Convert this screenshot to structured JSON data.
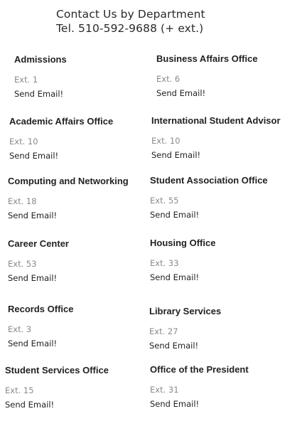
{
  "header": {
    "title": "Contact Us by Department",
    "phone": "Tel. 510-592-9688 (+ ext.)"
  },
  "departments": [
    {
      "name": "Admissions",
      "ext": "Ext. 1",
      "email_label": "Send Email!"
    },
    {
      "name": "Business Affairs Office",
      "ext": "Ext. 6",
      "email_label": "Send Email!"
    },
    {
      "name": "Academic Affairs Office",
      "ext": "Ext. 10",
      "email_label": "Send Email!"
    },
    {
      "name": "International Student Advisor",
      "ext": "Ext. 10",
      "email_label": "Send Email!"
    },
    {
      "name": "Computing and Networking",
      "ext": "Ext. 18",
      "email_label": "Send Email!"
    },
    {
      "name": "Student Association Office",
      "ext": "Ext. 55",
      "email_label": "Send Email!"
    },
    {
      "name": "Career Center",
      "ext": "Ext. 53",
      "email_label": "Send Email!"
    },
    {
      "name": "Housing Office",
      "ext": "Ext. 33",
      "email_label": "Send Email!"
    },
    {
      "name": "Records Office",
      "ext": "Ext. 3",
      "email_label": "Send Email!"
    },
    {
      "name": "Library Services",
      "ext": "Ext. 27",
      "email_label": "Send Email!"
    },
    {
      "name": "Student Services Office",
      "ext": "Ext. 15",
      "email_label": "Send Email!"
    },
    {
      "name": "Office of the President",
      "ext": "Ext. 31",
      "email_label": "Send Email!"
    }
  ]
}
